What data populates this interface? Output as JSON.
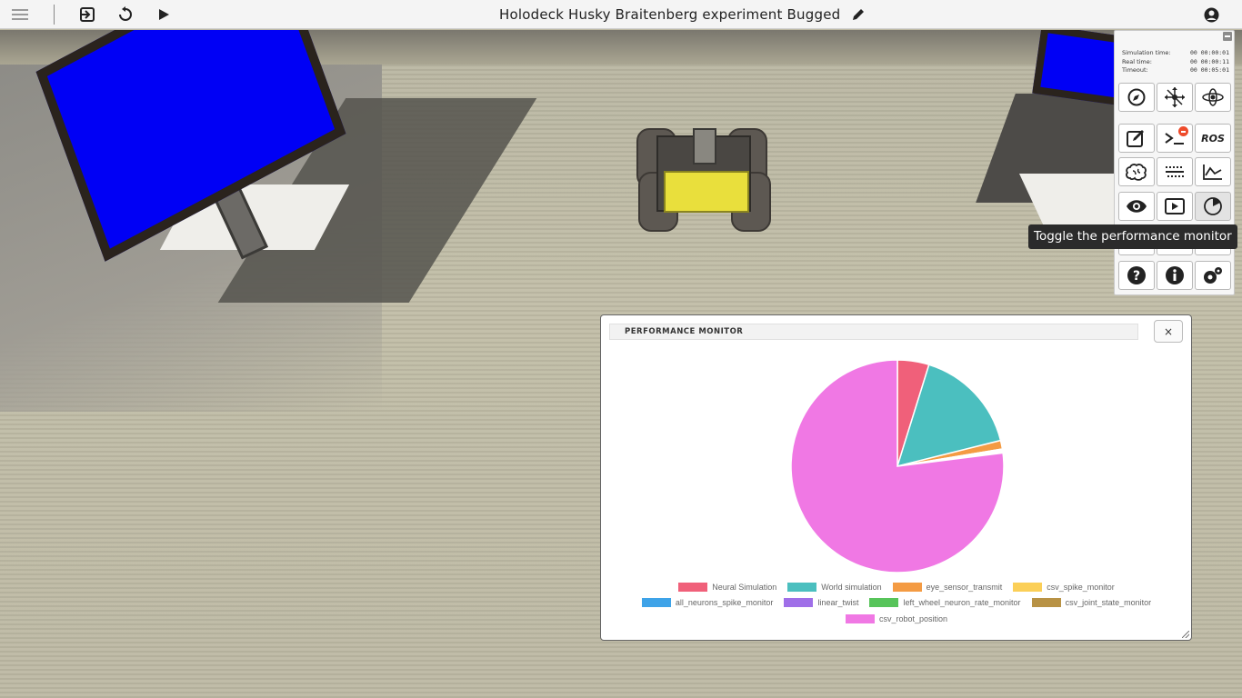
{
  "toolbar": {
    "title": "Holodeck Husky Braitenberg experiment Bugged",
    "buttons": [
      "menu-icon",
      "exit-icon",
      "reset-icon",
      "play-icon",
      "edit-icon",
      "user-icon"
    ]
  },
  "sim_panel": {
    "rows": [
      {
        "label": "Simulation time:",
        "value": "00 00:00:01"
      },
      {
        "label": "Real time:",
        "value": "00 00:00:11"
      },
      {
        "label": "Timeout:",
        "value": "00 00:05:01"
      }
    ],
    "ros_label": "ROS",
    "tools": [
      "navigation-icon",
      "move-icon",
      "orbit-icon",
      "editor-icon",
      "terminal-icon",
      "ros-button",
      "brain-icon",
      "spike-train-icon",
      "plot-icon",
      "eye-icon",
      "video-icon",
      "performance-icon",
      "help-icon",
      "info-icon",
      "settings-icon"
    ]
  },
  "tooltip": "Toggle the performance monitor",
  "perf_monitor": {
    "title": "PERFORMANCE MONITOR",
    "close_label": "×"
  },
  "chart_data": {
    "type": "pie",
    "start_angle": "top, clockwise",
    "slices": [
      {
        "name": "Neural Simulation",
        "value": 4.8,
        "color": "#f0607a"
      },
      {
        "name": "World simulation",
        "value": 16.3,
        "color": "#4bbfbf"
      },
      {
        "name": "eye_sensor_transmit",
        "value": 1.3,
        "color": "#f49b43"
      },
      {
        "name": "csv_spike_monitor",
        "value": 0.2,
        "color": "#fbcf57"
      },
      {
        "name": "all_neurons_spike_monitor",
        "value": 0.1,
        "color": "#3ea3e8"
      },
      {
        "name": "linear_twist",
        "value": 0.1,
        "color": "#9f6fe8"
      },
      {
        "name": "left_wheel_neuron_rate_monitor",
        "value": 0.1,
        "color": "#57c45a"
      },
      {
        "name": "csv_joint_state_monitor",
        "value": 0.1,
        "color": "#b89245"
      },
      {
        "name": "csv_robot_position",
        "value": 77.0,
        "color": "#f078e4"
      }
    ],
    "legend": [
      [
        "Neural Simulation",
        "World simulation",
        "eye_sensor_transmit",
        "csv_spike_monitor"
      ],
      [
        "all_neurons_spike_monitor",
        "linear_twist",
        "left_wheel_neuron_rate_monitor",
        "csv_joint_state_monitor"
      ],
      [
        "csv_robot_position"
      ]
    ],
    "legend_position": "bottom"
  }
}
